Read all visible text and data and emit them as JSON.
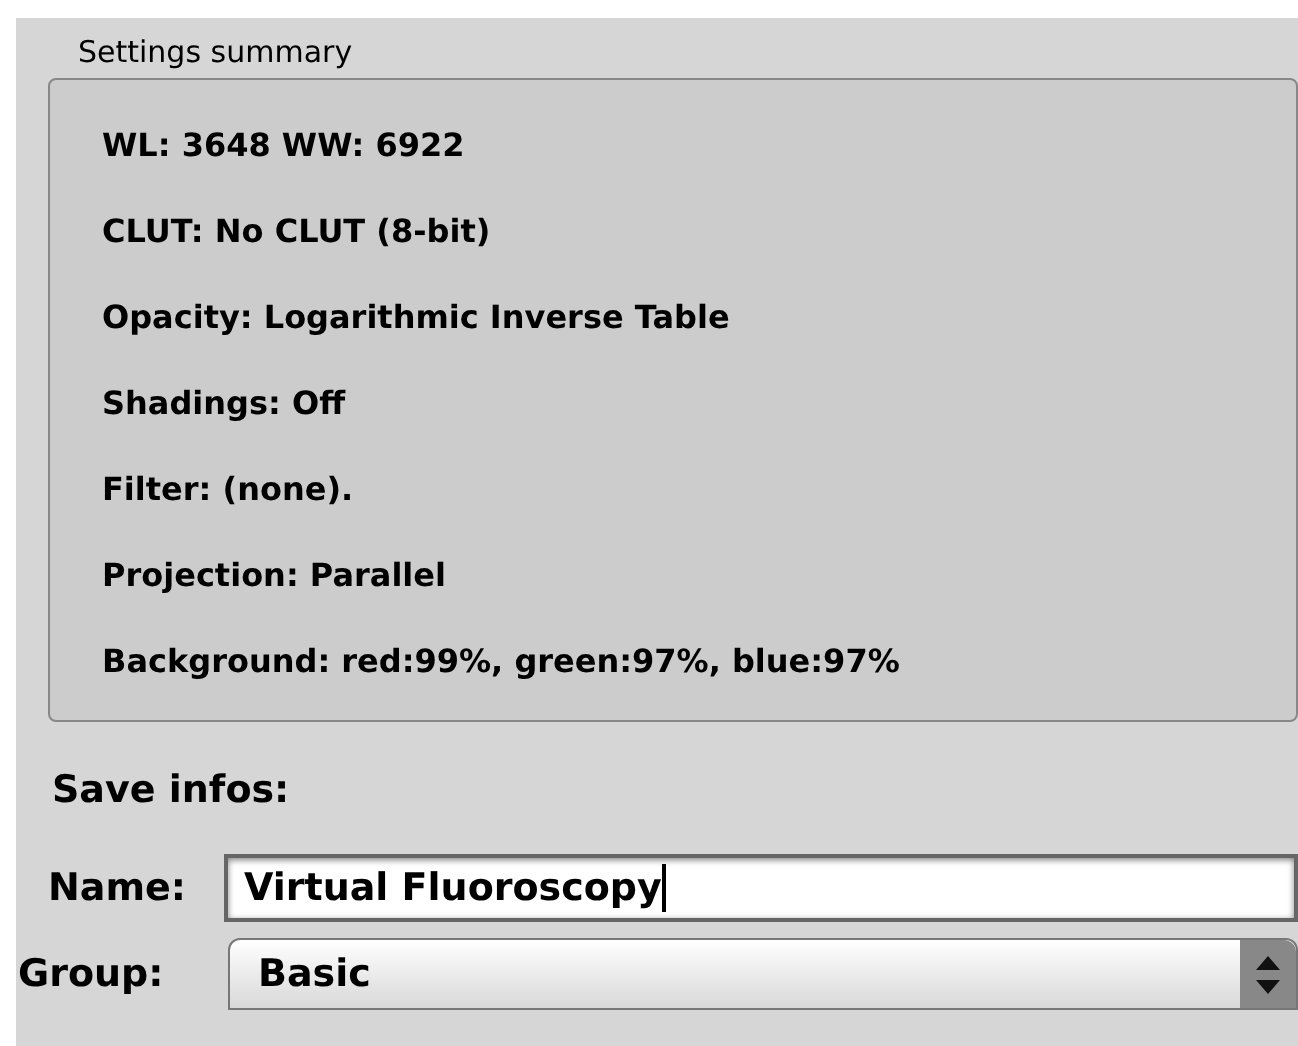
{
  "settings_summary": {
    "title": "Settings summary",
    "lines": [
      "WL: 3648 WW: 6922",
      "CLUT: No CLUT (8-bit)",
      "Opacity: Logarithmic Inverse Table",
      "Shadings: Off",
      "Filter: (none).",
      "Projection: Parallel",
      "Background: red:99%, green:97%, blue:97%"
    ]
  },
  "save_infos": {
    "title": "Save infos:",
    "name": {
      "label": "Name:",
      "value": "Virtual Fluoroscopy"
    },
    "group": {
      "label": "Group:",
      "value": "Basic"
    }
  }
}
